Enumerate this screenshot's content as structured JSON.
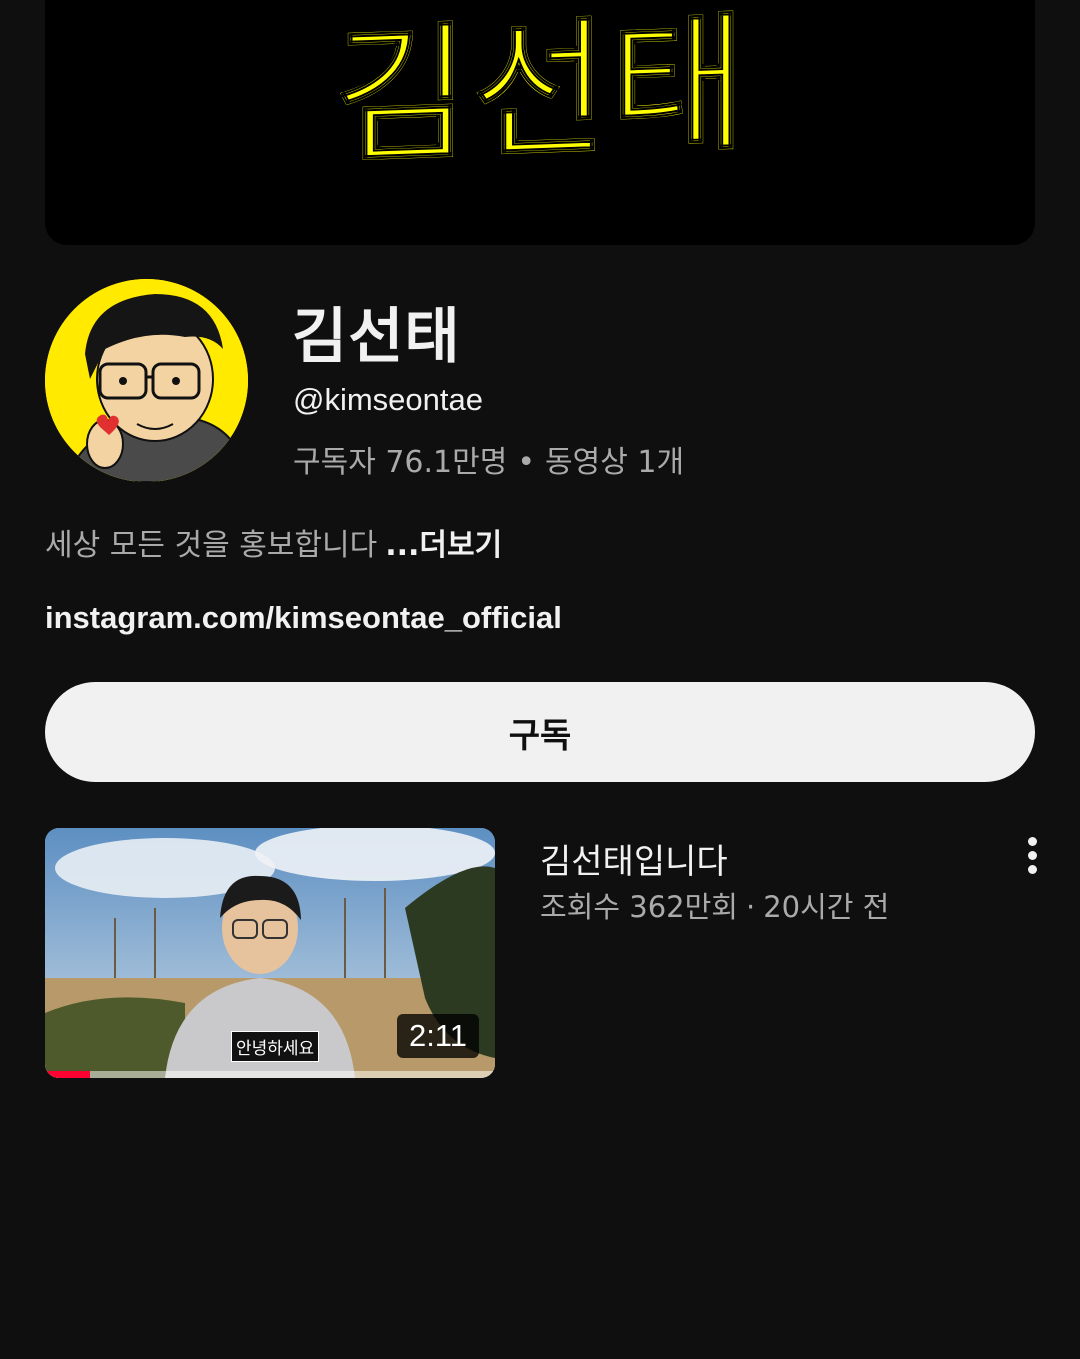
{
  "banner": {
    "logo_text": "김선태",
    "logo_color": "#ffff00"
  },
  "channel": {
    "name": "김선태",
    "handle": "@kimseontae",
    "subscribers": "구독자 76.1만명",
    "stats_separator": "•",
    "video_count": "동영상 1개",
    "description": "세상 모든 것을 홍보합니다",
    "more_label": "...더보기",
    "link": "instagram.com/kimseontae_official",
    "avatar_bg": "#ffea00"
  },
  "subscribe": {
    "label": "구독"
  },
  "videos": [
    {
      "title": "김선태입니다",
      "views": "조회수 362만회",
      "meta_separator": "·",
      "age": "20시간 전",
      "duration": "2:11",
      "caption": "안녕하세요",
      "watch_progress": 0.1,
      "menu_icon": "more-vert-icon"
    }
  ],
  "colors": {
    "background": "#0f0f0f",
    "progress": "#ff0033",
    "subscribe_bg": "#f1f1f1"
  }
}
